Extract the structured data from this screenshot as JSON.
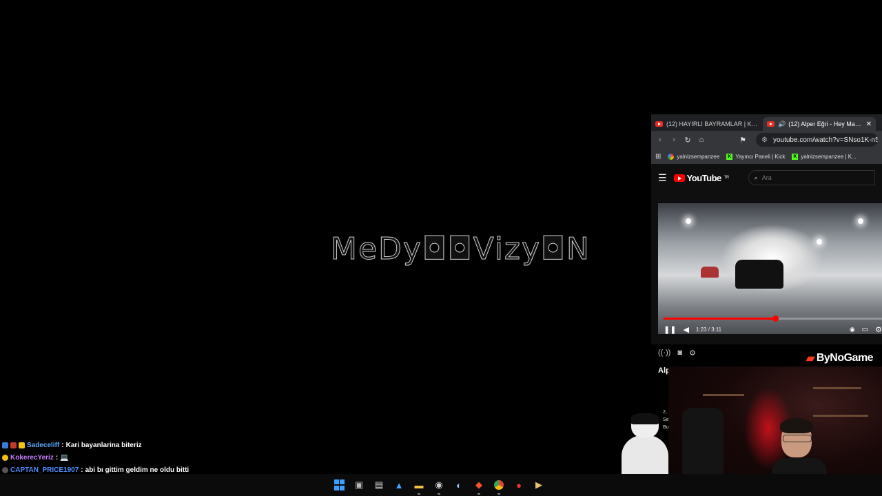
{
  "logo": {
    "text": "MeDy◘◘Vizy◘N"
  },
  "browser": {
    "tabs": [
      {
        "title": "(12) HAYIRLI BAYRAMLAR | Kanser ol",
        "active": false
      },
      {
        "title": "(12) Alper Eğri - Hey Mami | T",
        "active": true,
        "audio_icon": "speaker-icon"
      }
    ],
    "close_glyph": "✕",
    "url": "youtube.com/watch?v=SNso1K-n5TE",
    "bookmarks": [
      {
        "icon": "google-icon",
        "label": "yalnizsempanzee"
      },
      {
        "icon": "kick-icon",
        "label": "Yayıncı Paneli | Kick"
      },
      {
        "icon": "kick-icon",
        "label": "yalnizsempanzee | K..."
      }
    ]
  },
  "youtube": {
    "logo_text": "YouTube",
    "region": "TR",
    "search_placeholder": "Ara",
    "player": {
      "time": "1:23 / 3:11",
      "progress": 0.51,
      "buffered": 0.62
    }
  },
  "sidebar": {
    "heading": "Alp",
    "text_lines": [
      "2,",
      "Se",
      "Bu"
    ],
    "extra": "1"
  },
  "overlay": {
    "brand": "ByNoGame"
  },
  "chat": [
    {
      "user": "Sadeceliff",
      "sep": ":",
      "text": "Kari bayanlarina biteriz",
      "color": "#5aa9ff"
    },
    {
      "user": "KokerecYeriz",
      "sep": ":",
      "text": "💻",
      "color": "#c77dff"
    },
    {
      "user": "CAPTAN_PRICE1907",
      "sep": ":",
      "text": "abi bı gittim geldim ne oldu bitti",
      "color": "#4c8dff"
    }
  ],
  "taskbar": {
    "icons": [
      "windows-start-icon",
      "task-view-icon",
      "app-icon",
      "photos-icon",
      "file-explorer-icon",
      "obs-icon",
      "steam-icon",
      "brave-icon",
      "chrome-icon",
      "red-app-icon",
      "media-icon"
    ]
  }
}
